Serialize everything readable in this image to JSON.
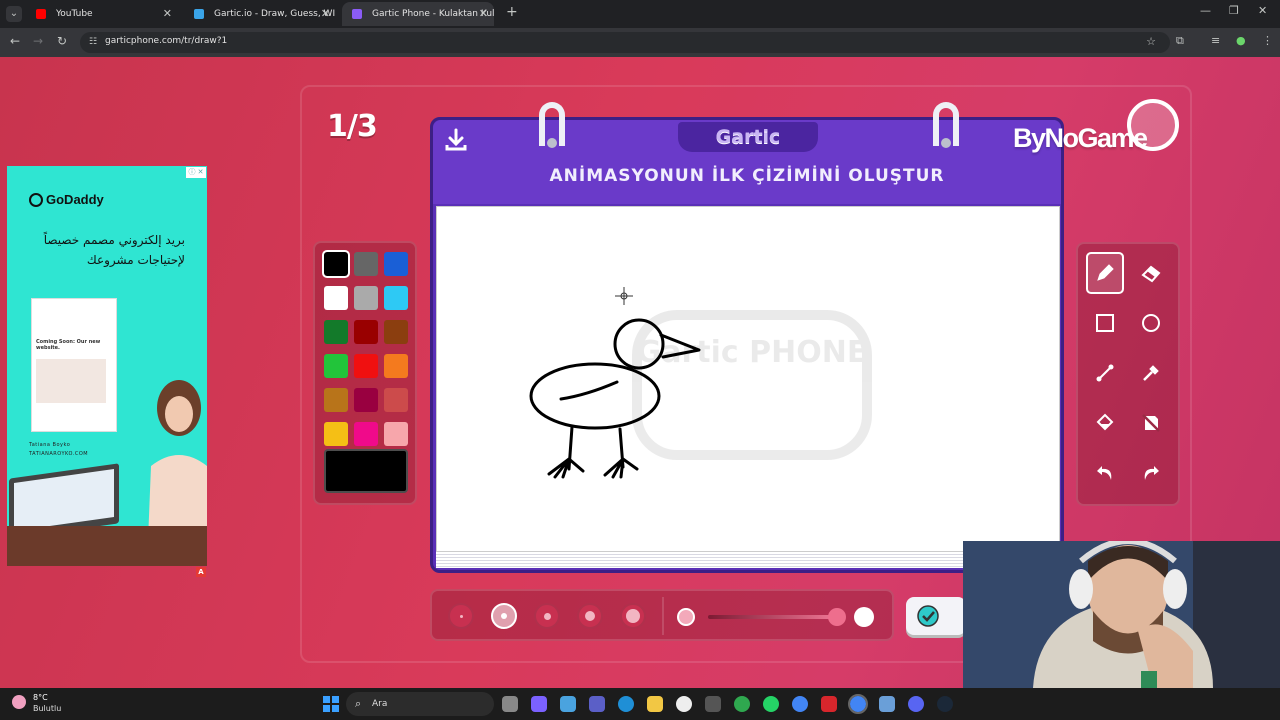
{
  "browser": {
    "tabs": [
      {
        "title": "YouTube",
        "active": false,
        "favicon_color": "#ff0000"
      },
      {
        "title": "Gartic.io - Draw, Guess, WIN",
        "active": false,
        "favicon_color": "#3aa4e8"
      },
      {
        "title": "Gartic Phone - Kulaktan Kulağa",
        "active": true,
        "favicon_color": "#8b5cf6"
      }
    ],
    "url": "garticphone.com/tr/draw?1"
  },
  "game": {
    "round_counter": "1/3",
    "logo": "Gartic",
    "instruction": "ANİMASYONUN İLK ÇİZİMİNİ OLUŞTUR",
    "watermark": "Gartic PHONE",
    "selected_color": "#000000",
    "selected_tool": "pencil",
    "selected_brush_size": 2,
    "colors": [
      "#000000",
      "#666666",
      "#1a5fd6",
      "#ffffff",
      "#aaaaaa",
      "#2ec9f4",
      "#137a2a",
      "#990000",
      "#8b3e0f",
      "#22c43a",
      "#f01010",
      "#f47a1e",
      "#b8741a",
      "#990040",
      "#cc4b4b",
      "#f5bf15",
      "#f00a8a",
      "#f7a6ab"
    ],
    "tools": [
      "pencil",
      "eraser",
      "rectangle",
      "ellipse",
      "line",
      "eyedropper",
      "fill",
      "clear",
      "undo",
      "redo"
    ]
  },
  "ad": {
    "brand": "GoDaddy",
    "headline": "بريد إلكتروني مصمم خصيصاً لإحتياجات مشروعك",
    "mail_text": "Coming Soon: Our new website.",
    "person_name": "Tatiana Boyko",
    "person_url": "TATIANAROYKO.COM"
  },
  "streamer_logo": "ByNoGame",
  "taskbar": {
    "temperature": "8°C",
    "condition": "Bulutlu",
    "search_placeholder": "Ara"
  }
}
